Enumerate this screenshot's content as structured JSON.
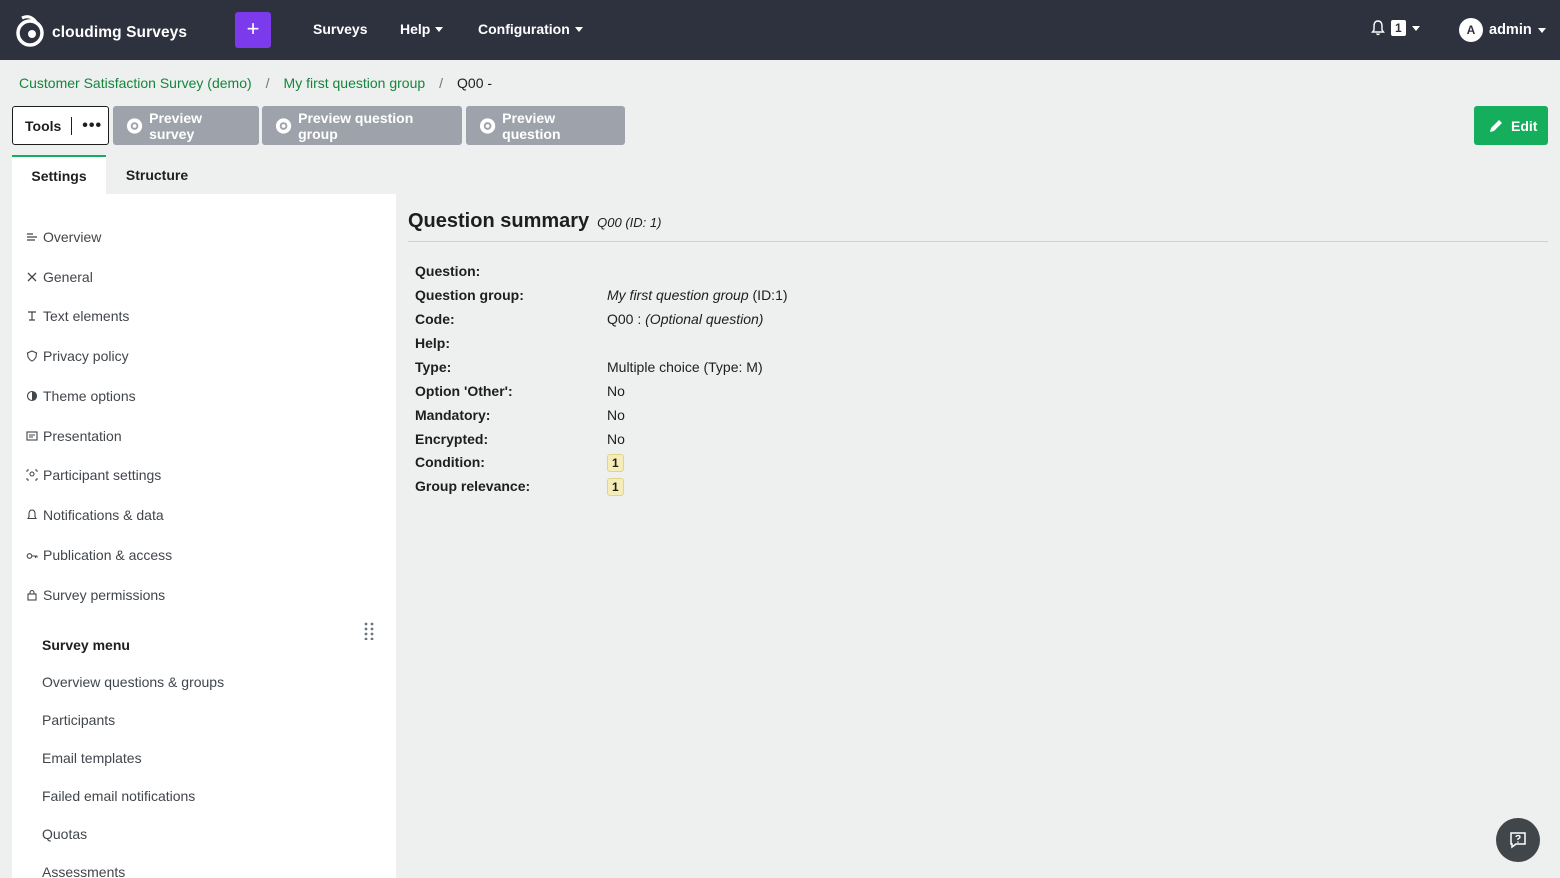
{
  "navbar": {
    "brand": "cloudimg Surveys",
    "add_label": "+",
    "items": [
      "Surveys",
      "Help",
      "Configuration"
    ],
    "notification_count": "1",
    "user_initial": "A",
    "user_name": "admin"
  },
  "breadcrumb": {
    "items": [
      "Customer Satisfaction Survey (demo)",
      "My first question group"
    ],
    "current": "Q00 -",
    "separator": "/"
  },
  "toolbar": {
    "tools_label": "Tools",
    "more_label": "•••",
    "preview_survey": "Preview survey",
    "preview_group": "Preview question group",
    "preview_question": "Preview question",
    "edit_label": "Edit"
  },
  "tabs": {
    "settings": "Settings",
    "structure": "Structure"
  },
  "sidebar": {
    "items": [
      {
        "label": "Overview",
        "icon": "overview-icon"
      },
      {
        "label": "General",
        "icon": "tools-icon"
      },
      {
        "label": "Text elements",
        "icon": "text-icon"
      },
      {
        "label": "Privacy policy",
        "icon": "shield-icon"
      },
      {
        "label": "Theme options",
        "icon": "contrast-icon"
      },
      {
        "label": "Presentation",
        "icon": "presentation-icon"
      },
      {
        "label": "Participant settings",
        "icon": "participant-icon"
      },
      {
        "label": "Notifications & data",
        "icon": "bell-icon"
      },
      {
        "label": "Publication & access",
        "icon": "key-icon"
      },
      {
        "label": "Survey permissions",
        "icon": "lock-icon"
      }
    ],
    "menu_title": "Survey menu",
    "menu_items": [
      "Overview questions & groups",
      "Participants",
      "Email templates",
      "Failed email notifications",
      "Quotas",
      "Assessments"
    ]
  },
  "summary": {
    "title": "Question summary",
    "subtitle": "Q00 (ID: 1)",
    "rows": {
      "question": {
        "label": "Question:",
        "value": ""
      },
      "group": {
        "label": "Question group:",
        "value_italic": "My first question group",
        "value_suffix": " (ID:1)"
      },
      "code": {
        "label": "Code:",
        "value": "Q00 : ",
        "value_italic": "(Optional question)"
      },
      "help": {
        "label": "Help:",
        "value": ""
      },
      "type": {
        "label": "Type:",
        "value": "Multiple choice (Type: M)"
      },
      "other": {
        "label": "Option 'Other':",
        "value": "No"
      },
      "mandatory": {
        "label": "Mandatory:",
        "value": "No"
      },
      "encrypted": {
        "label": "Encrypted:",
        "value": "No"
      },
      "condition": {
        "label": "Condition:",
        "value": "1"
      },
      "relevance": {
        "label": "Group relevance:",
        "value": "1"
      }
    }
  },
  "colors": {
    "navbar_bg": "#2e323e",
    "accent_purple": "#7c3aed",
    "link_green": "#14863c",
    "edit_green": "#14ae5c",
    "preview_gray": "#9ea3ab"
  }
}
